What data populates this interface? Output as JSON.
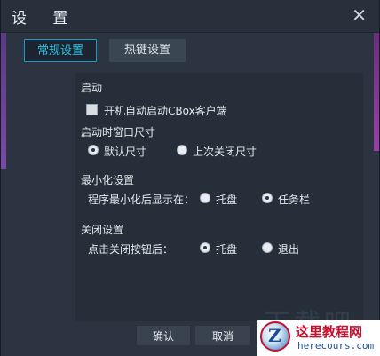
{
  "window": {
    "title": "设 置"
  },
  "tabs": [
    {
      "label": "常规设置",
      "active": true
    },
    {
      "label": "热键设置",
      "active": false
    }
  ],
  "startup": {
    "section_label": "启动",
    "autostart_label": "开机自动启动CBox客户端",
    "autostart_checked": false
  },
  "window_size": {
    "section_label": "启动时窗口尺寸",
    "options": [
      {
        "label": "默认尺寸",
        "selected": true
      },
      {
        "label": "上次关闭尺寸",
        "selected": false
      }
    ]
  },
  "minimize": {
    "section_label": "最小化设置",
    "prompt": "程序最小化后显示在：",
    "options": [
      {
        "label": "托盘",
        "selected": false
      },
      {
        "label": "任务栏",
        "selected": true
      }
    ]
  },
  "close": {
    "section_label": "关闭设置",
    "prompt": "点击关闭按钮后：",
    "options": [
      {
        "label": "托盘",
        "selected": true
      },
      {
        "label": "退出",
        "selected": false
      }
    ]
  },
  "buttons": {
    "confirm": "确认",
    "cancel": "取消"
  },
  "watermark": {
    "text": "下载吧",
    "logo_letter": "Z",
    "site_name": "这里教程网",
    "site_url": "herecours.com"
  },
  "colors": {
    "accent": "#2ec4e6",
    "background": "#2b3440",
    "logo_red": "#c8102e"
  }
}
